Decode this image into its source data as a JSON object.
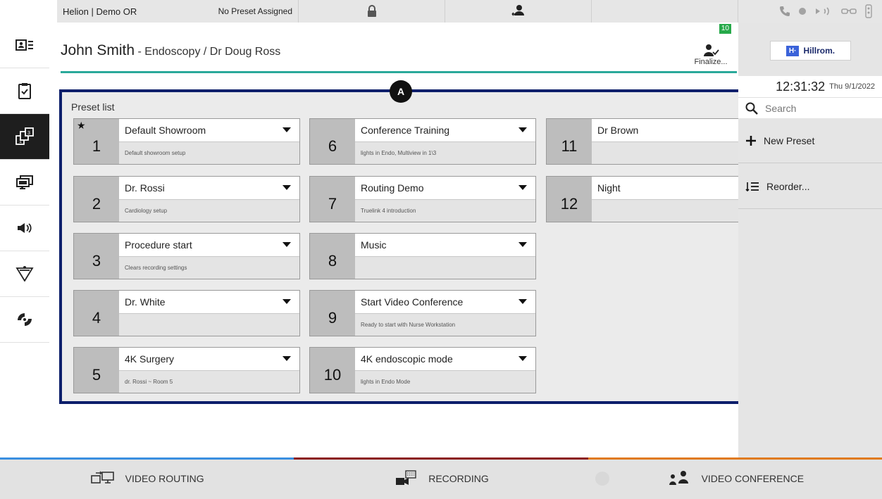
{
  "topbar": {
    "room": "Helion | Demo OR",
    "preset_status": "No Preset Assigned"
  },
  "header": {
    "patient_name": "John Smith",
    "procedure": " - Endoscopy / Dr Doug Ross",
    "finalize_label": "Finalize...",
    "finalize_badge": "10"
  },
  "panel": {
    "marker": "A",
    "title": "Preset list"
  },
  "presets": [
    {
      "number": "1",
      "name": "Default Showroom",
      "desc": "Default showroom setup",
      "favorite": true,
      "dropdown": true
    },
    {
      "number": "2",
      "name": "Dr. Rossi",
      "desc": "Cardiology setup",
      "dropdown": true
    },
    {
      "number": "3",
      "name": "Procedure start",
      "desc": "Clears recording settings",
      "dropdown": true
    },
    {
      "number": "4",
      "name": "Dr. White",
      "desc": "",
      "dropdown": true
    },
    {
      "number": "5",
      "name": "4K Surgery",
      "desc": "dr. Rossi ~ Room 5",
      "dropdown": true
    },
    {
      "number": "6",
      "name": "Conference Training",
      "desc": "lights in Endo, Multiview in 1\\3",
      "dropdown": true
    },
    {
      "number": "7",
      "name": "Routing Demo",
      "desc": "Truelink 4 introduction",
      "dropdown": true
    },
    {
      "number": "8",
      "name": "Music",
      "desc": "",
      "dropdown": true
    },
    {
      "number": "9",
      "name": "Start Video Conference",
      "desc": "Ready to start with Nurse Workstation",
      "dropdown": true
    },
    {
      "number": "10",
      "name": "4K endoscopic mode",
      "desc": "lights in Endo Mode",
      "dropdown": true
    },
    {
      "number": "11",
      "name": "Dr Brown",
      "desc": "",
      "dropdown": false
    },
    {
      "number": "12",
      "name": "Night",
      "desc": "",
      "dropdown": false
    }
  ],
  "right": {
    "brand": "Hillrom.",
    "brand_mark": "H·",
    "time": "12:31:32",
    "date": "Thu 9/1/2022",
    "search_placeholder": "Search",
    "new_preset": "New Preset",
    "reorder": "Reorder..."
  },
  "bottom": {
    "tabs": [
      {
        "label": "VIDEO ROUTING",
        "color": "#3a8fe0"
      },
      {
        "label": "RECORDING",
        "color": "#8b1a1a"
      },
      {
        "label": "VIDEO CONFERENCE",
        "color": "#e07a1a"
      }
    ]
  },
  "colors": {
    "panel_border": "#0d1f6b",
    "accent_line": "#2aa99a",
    "finalize_badge": "#27a94a"
  }
}
